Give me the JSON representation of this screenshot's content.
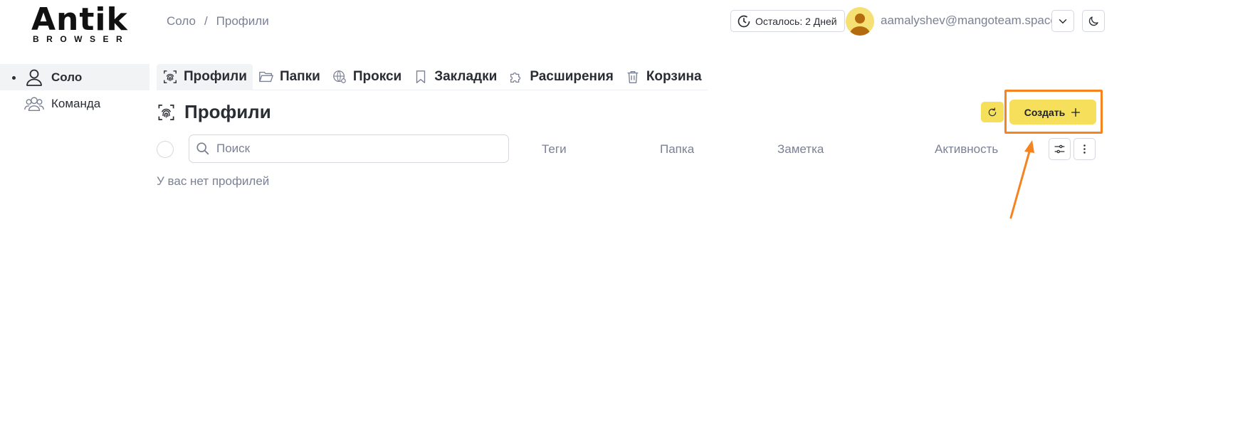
{
  "logo": {
    "main": "Antik",
    "sub": "BROWSER"
  },
  "breadcrumb": {
    "root": "Соло",
    "separator": "/",
    "current": "Профили"
  },
  "header": {
    "trial_text": "Осталось: 2 Дней",
    "email": "aamalyshev@mangoteam.space",
    "icons": {
      "trial": "clock-icon",
      "menu": "chevron-down-icon",
      "theme": "moon-icon"
    }
  },
  "sidebar": {
    "items": [
      {
        "label": "Соло",
        "icon": "user-icon",
        "active": true
      },
      {
        "label": "Команда",
        "icon": "team-icon",
        "active": false
      }
    ]
  },
  "tabs": [
    {
      "label": "Профили",
      "icon": "fingerprint-icon",
      "active": true
    },
    {
      "label": "Папки",
      "icon": "folder-icon",
      "active": false
    },
    {
      "label": "Прокси",
      "icon": "globe-icon",
      "active": false
    },
    {
      "label": "Закладки",
      "icon": "bookmark-icon",
      "active": false
    },
    {
      "label": "Расширения",
      "icon": "puzzle-icon",
      "active": false
    },
    {
      "label": "Корзина",
      "icon": "trash-icon",
      "active": false
    }
  ],
  "main": {
    "title": "Профили",
    "create_label": "Создать",
    "search_placeholder": "Поиск",
    "columns": [
      "Теги",
      "Папка",
      "Заметка",
      "Активность"
    ],
    "empty_text": "У вас нет профилей"
  },
  "colors": {
    "accent": "#f6df5b",
    "highlight": "#f5831f",
    "muted": "#7b8194"
  }
}
